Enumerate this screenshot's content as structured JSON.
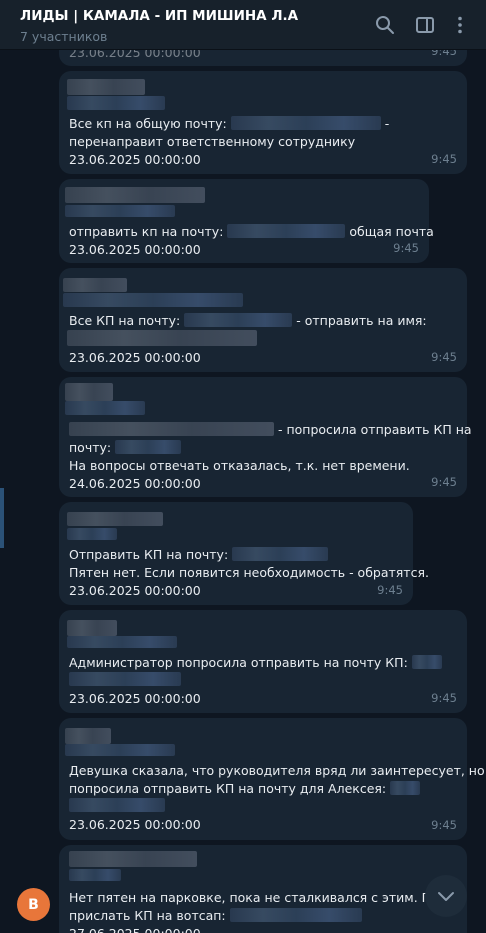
{
  "header": {
    "title": "ЛИДЫ | КАМАЛА - ИП МИШИНА Л.А",
    "subtitle": "7 участников",
    "icons": [
      "search-icon",
      "sidebar-icon",
      "more-icon"
    ]
  },
  "avatar": {
    "letter": "B",
    "color": "#e8763a"
  },
  "messages": [
    {
      "date": "23.06.2025 00:00:00",
      "time": "9:45"
    },
    {
      "line1_a": "Все кп на общую почту:",
      "line1_b": " -",
      "line2": "перенаправит ответственному сотруднику",
      "date": "23.06.2025 00:00:00",
      "time": "9:45"
    },
    {
      "line1_a": "отправить кп на почту:",
      "line1_b": "общая почта",
      "date": "23.06.2025 00:00:00",
      "time": "9:45"
    },
    {
      "line1_a": "Все КП на почту:",
      "line1_b": "- отправить на имя:",
      "date": "23.06.2025 00:00:00",
      "time": "9:45"
    },
    {
      "line1_b": "- попросила отправить КП на",
      "line2": "почту:",
      "line3": "На вопросы отвечать отказалась, т.к. нет времени.",
      "date": "24.06.2025 00:00:00",
      "time": "9:45"
    },
    {
      "line1": "Отправить КП на почту:",
      "line2": "Пятен нет. Если появится необходимость - обратятся.",
      "date": "23.06.2025 00:00:00",
      "time": "9:45"
    },
    {
      "line1": "Администратор попросила отправить на почту КП:",
      "date": "23.06.2025 00:00:00",
      "time": "9:45"
    },
    {
      "line1": "Девушка сказала, что руководителя вряд ли заинтересует, но",
      "line2": "попросила отправить КП на почту для Алексея:",
      "date": "23.06.2025 00:00:00",
      "time": "9:45"
    },
    {
      "line1": "Нет пятен на парковке, пока не сталкивался с этим. Попр",
      "line2": "прислать КП на вотсап:",
      "date": "27.06.2025 00:00:00"
    }
  ]
}
